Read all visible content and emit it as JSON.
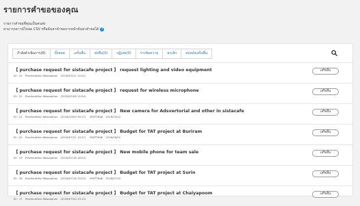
{
  "page": {
    "title": "รายการคำขอของคุณ",
    "intro_line1": "รายการคำขอที่คุณเป็นคนส่ง",
    "intro_line2": "สามารถดาวน์โหลด CSV หรือค้นหาคำขอจากหน้าค้นหาคำขอได้"
  },
  "tabs": [
    {
      "label": "กำลังดำเนินการ(0)",
      "active": true
    },
    {
      "label": "ทั้งหมด"
    },
    {
      "label": "เสร็จสิ้น"
    },
    {
      "label": "ส่งคืน(0)"
    },
    {
      "label": "ปฏิเสธ(0)"
    },
    {
      "label": "ร่างข้อความ"
    },
    {
      "label": "ยกเลิก"
    },
    {
      "label": "ลบหลังเสร็จสิ้น"
    }
  ],
  "detail_button_label": "เสร็จสิ้น",
  "requests": [
    {
      "title": "【 purchase request for sistacafe project 】 request lighting and video equipment",
      "id": "ID : 24",
      "applicant": "Pracheuttikul Wassaphon",
      "submitted": "(2018/03/11 14:01)",
      "due_label": "",
      "due_date": ""
    },
    {
      "title": "【 purchase request for sistacafe project 】 request for wireless microphone",
      "id": "ID : 22",
      "applicant": "Pracheuttikul Wassaphon",
      "submitted": "(2018/02/08 12:54)",
      "due_label": "",
      "due_date": ""
    },
    {
      "title": "【 purchase request for sistacafe project 】 New camera for Adsvertorial and other in sistacafe",
      "id": "ID : 21",
      "applicant": "Pracheuttikul Wassaphon",
      "submitted": "(2018/10/09 16:17)",
      "due_label": "ครบกำหนด",
      "due_date": "2018/10/12"
    },
    {
      "title": "【 purchase request for sistacafe project 】 Budget for TAT project at Buriram",
      "id": "ID : 20",
      "applicant": "Pracheuttikul Wassaphon",
      "submitted": "(2018/07/31 10:37)",
      "due_label": "ครบกำหนด",
      "due_date": "2018/08/02"
    },
    {
      "title": "【 purchase request for sistacafe project 】 New mobile phone for team sale",
      "id": "ID : 19",
      "applicant": "Pracheuttikul Wassaphon",
      "submitted": "(2018/07/18 18:03)",
      "due_label": "",
      "due_date": ""
    },
    {
      "title": "【 purchase request for sistacafe project 】 Budget for TAT project at Surin",
      "id": "ID : 18",
      "applicant": "Pracheuttikul Wassaphon",
      "submitted": "(2018/07/18 19:23)",
      "due_label": "ครบกำหนด",
      "due_date": "2018/07/20"
    },
    {
      "title": "【 purchase request for sistacafe project 】 Budget for TAT project at Chaiyapoom",
      "id": "ID : 17",
      "applicant": "Pracheuttikul Wassaphon",
      "submitted": "(2018/07/04 13:12)",
      "due_label": "",
      "due_date": ""
    }
  ]
}
